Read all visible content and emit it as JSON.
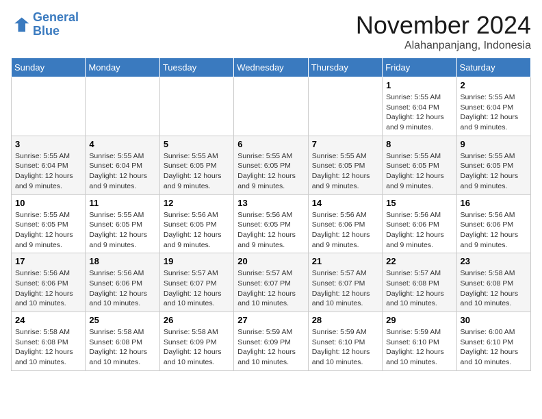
{
  "header": {
    "logo_line1": "General",
    "logo_line2": "Blue",
    "month": "November 2024",
    "location": "Alahanpanjang, Indonesia"
  },
  "weekdays": [
    "Sunday",
    "Monday",
    "Tuesday",
    "Wednesday",
    "Thursday",
    "Friday",
    "Saturday"
  ],
  "weeks": [
    [
      {
        "day": "",
        "info": ""
      },
      {
        "day": "",
        "info": ""
      },
      {
        "day": "",
        "info": ""
      },
      {
        "day": "",
        "info": ""
      },
      {
        "day": "",
        "info": ""
      },
      {
        "day": "1",
        "info": "Sunrise: 5:55 AM\nSunset: 6:04 PM\nDaylight: 12 hours and 9 minutes."
      },
      {
        "day": "2",
        "info": "Sunrise: 5:55 AM\nSunset: 6:04 PM\nDaylight: 12 hours and 9 minutes."
      }
    ],
    [
      {
        "day": "3",
        "info": "Sunrise: 5:55 AM\nSunset: 6:04 PM\nDaylight: 12 hours and 9 minutes."
      },
      {
        "day": "4",
        "info": "Sunrise: 5:55 AM\nSunset: 6:04 PM\nDaylight: 12 hours and 9 minutes."
      },
      {
        "day": "5",
        "info": "Sunrise: 5:55 AM\nSunset: 6:05 PM\nDaylight: 12 hours and 9 minutes."
      },
      {
        "day": "6",
        "info": "Sunrise: 5:55 AM\nSunset: 6:05 PM\nDaylight: 12 hours and 9 minutes."
      },
      {
        "day": "7",
        "info": "Sunrise: 5:55 AM\nSunset: 6:05 PM\nDaylight: 12 hours and 9 minutes."
      },
      {
        "day": "8",
        "info": "Sunrise: 5:55 AM\nSunset: 6:05 PM\nDaylight: 12 hours and 9 minutes."
      },
      {
        "day": "9",
        "info": "Sunrise: 5:55 AM\nSunset: 6:05 PM\nDaylight: 12 hours and 9 minutes."
      }
    ],
    [
      {
        "day": "10",
        "info": "Sunrise: 5:55 AM\nSunset: 6:05 PM\nDaylight: 12 hours and 9 minutes."
      },
      {
        "day": "11",
        "info": "Sunrise: 5:55 AM\nSunset: 6:05 PM\nDaylight: 12 hours and 9 minutes."
      },
      {
        "day": "12",
        "info": "Sunrise: 5:56 AM\nSunset: 6:05 PM\nDaylight: 12 hours and 9 minutes."
      },
      {
        "day": "13",
        "info": "Sunrise: 5:56 AM\nSunset: 6:05 PM\nDaylight: 12 hours and 9 minutes."
      },
      {
        "day": "14",
        "info": "Sunrise: 5:56 AM\nSunset: 6:06 PM\nDaylight: 12 hours and 9 minutes."
      },
      {
        "day": "15",
        "info": "Sunrise: 5:56 AM\nSunset: 6:06 PM\nDaylight: 12 hours and 9 minutes."
      },
      {
        "day": "16",
        "info": "Sunrise: 5:56 AM\nSunset: 6:06 PM\nDaylight: 12 hours and 9 minutes."
      }
    ],
    [
      {
        "day": "17",
        "info": "Sunrise: 5:56 AM\nSunset: 6:06 PM\nDaylight: 12 hours and 10 minutes."
      },
      {
        "day": "18",
        "info": "Sunrise: 5:56 AM\nSunset: 6:06 PM\nDaylight: 12 hours and 10 minutes."
      },
      {
        "day": "19",
        "info": "Sunrise: 5:57 AM\nSunset: 6:07 PM\nDaylight: 12 hours and 10 minutes."
      },
      {
        "day": "20",
        "info": "Sunrise: 5:57 AM\nSunset: 6:07 PM\nDaylight: 12 hours and 10 minutes."
      },
      {
        "day": "21",
        "info": "Sunrise: 5:57 AM\nSunset: 6:07 PM\nDaylight: 12 hours and 10 minutes."
      },
      {
        "day": "22",
        "info": "Sunrise: 5:57 AM\nSunset: 6:08 PM\nDaylight: 12 hours and 10 minutes."
      },
      {
        "day": "23",
        "info": "Sunrise: 5:58 AM\nSunset: 6:08 PM\nDaylight: 12 hours and 10 minutes."
      }
    ],
    [
      {
        "day": "24",
        "info": "Sunrise: 5:58 AM\nSunset: 6:08 PM\nDaylight: 12 hours and 10 minutes."
      },
      {
        "day": "25",
        "info": "Sunrise: 5:58 AM\nSunset: 6:08 PM\nDaylight: 12 hours and 10 minutes."
      },
      {
        "day": "26",
        "info": "Sunrise: 5:58 AM\nSunset: 6:09 PM\nDaylight: 12 hours and 10 minutes."
      },
      {
        "day": "27",
        "info": "Sunrise: 5:59 AM\nSunset: 6:09 PM\nDaylight: 12 hours and 10 minutes."
      },
      {
        "day": "28",
        "info": "Sunrise: 5:59 AM\nSunset: 6:10 PM\nDaylight: 12 hours and 10 minutes."
      },
      {
        "day": "29",
        "info": "Sunrise: 5:59 AM\nSunset: 6:10 PM\nDaylight: 12 hours and 10 minutes."
      },
      {
        "day": "30",
        "info": "Sunrise: 6:00 AM\nSunset: 6:10 PM\nDaylight: 12 hours and 10 minutes."
      }
    ]
  ]
}
